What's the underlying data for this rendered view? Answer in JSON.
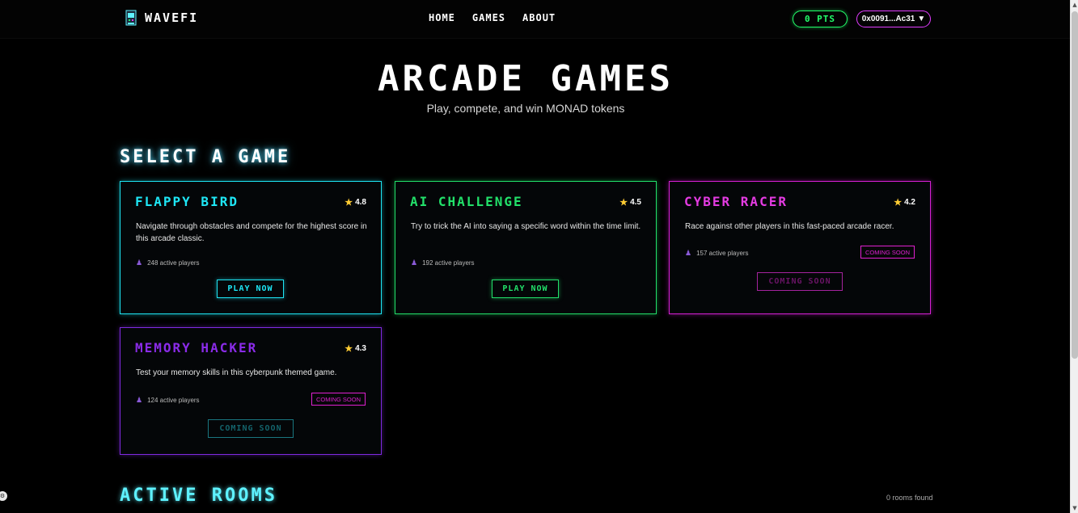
{
  "header": {
    "brand": "WAVEFI",
    "nav": [
      {
        "label": "HOME"
      },
      {
        "label": "GAMES"
      },
      {
        "label": "ABOUT"
      }
    ],
    "points": "0 PTS",
    "wallet": "0x0091...Ac31",
    "wallet_caret": "▼"
  },
  "hero": {
    "title": "ARCADE GAMES",
    "subtitle": "Play, compete, and win MONAD tokens"
  },
  "select_section": {
    "title": "SELECT A GAME"
  },
  "games": [
    {
      "title": "FLAPPY BIRD",
      "rating": "4.8",
      "description": "Navigate through obstacles and compete for the highest score in this arcade classic.",
      "players": "248 active players",
      "button": "PLAY NOW",
      "color": "#1ee6f5"
    },
    {
      "title": "AI CHALLENGE",
      "rating": "4.5",
      "description": "Try to trick the AI into saying a specific word within the time limit.",
      "players": "192 active players",
      "button": "PLAY NOW",
      "color": "#22e06a"
    },
    {
      "title": "CYBER RACER",
      "rating": "4.2",
      "description": "Race against other players in this fast-paced arcade racer.",
      "players": "157 active players",
      "badge": "COMING SOON",
      "button": "COMING SOON",
      "color": "#e43be2"
    },
    {
      "title": "MEMORY HACKER",
      "rating": "4.3",
      "description": "Test your memory skills in this cyberpunk themed game.",
      "players": "124 active players",
      "badge": "COMING SOON",
      "button": "COMING SOON",
      "color": "#8a2be8"
    }
  ],
  "rooms_section": {
    "title": "ACTIVE ROOMS",
    "count": "0 rooms found"
  },
  "icons": {
    "logo": "arcade-cabinet-icon",
    "star": "star-icon",
    "players": "person-icon"
  }
}
